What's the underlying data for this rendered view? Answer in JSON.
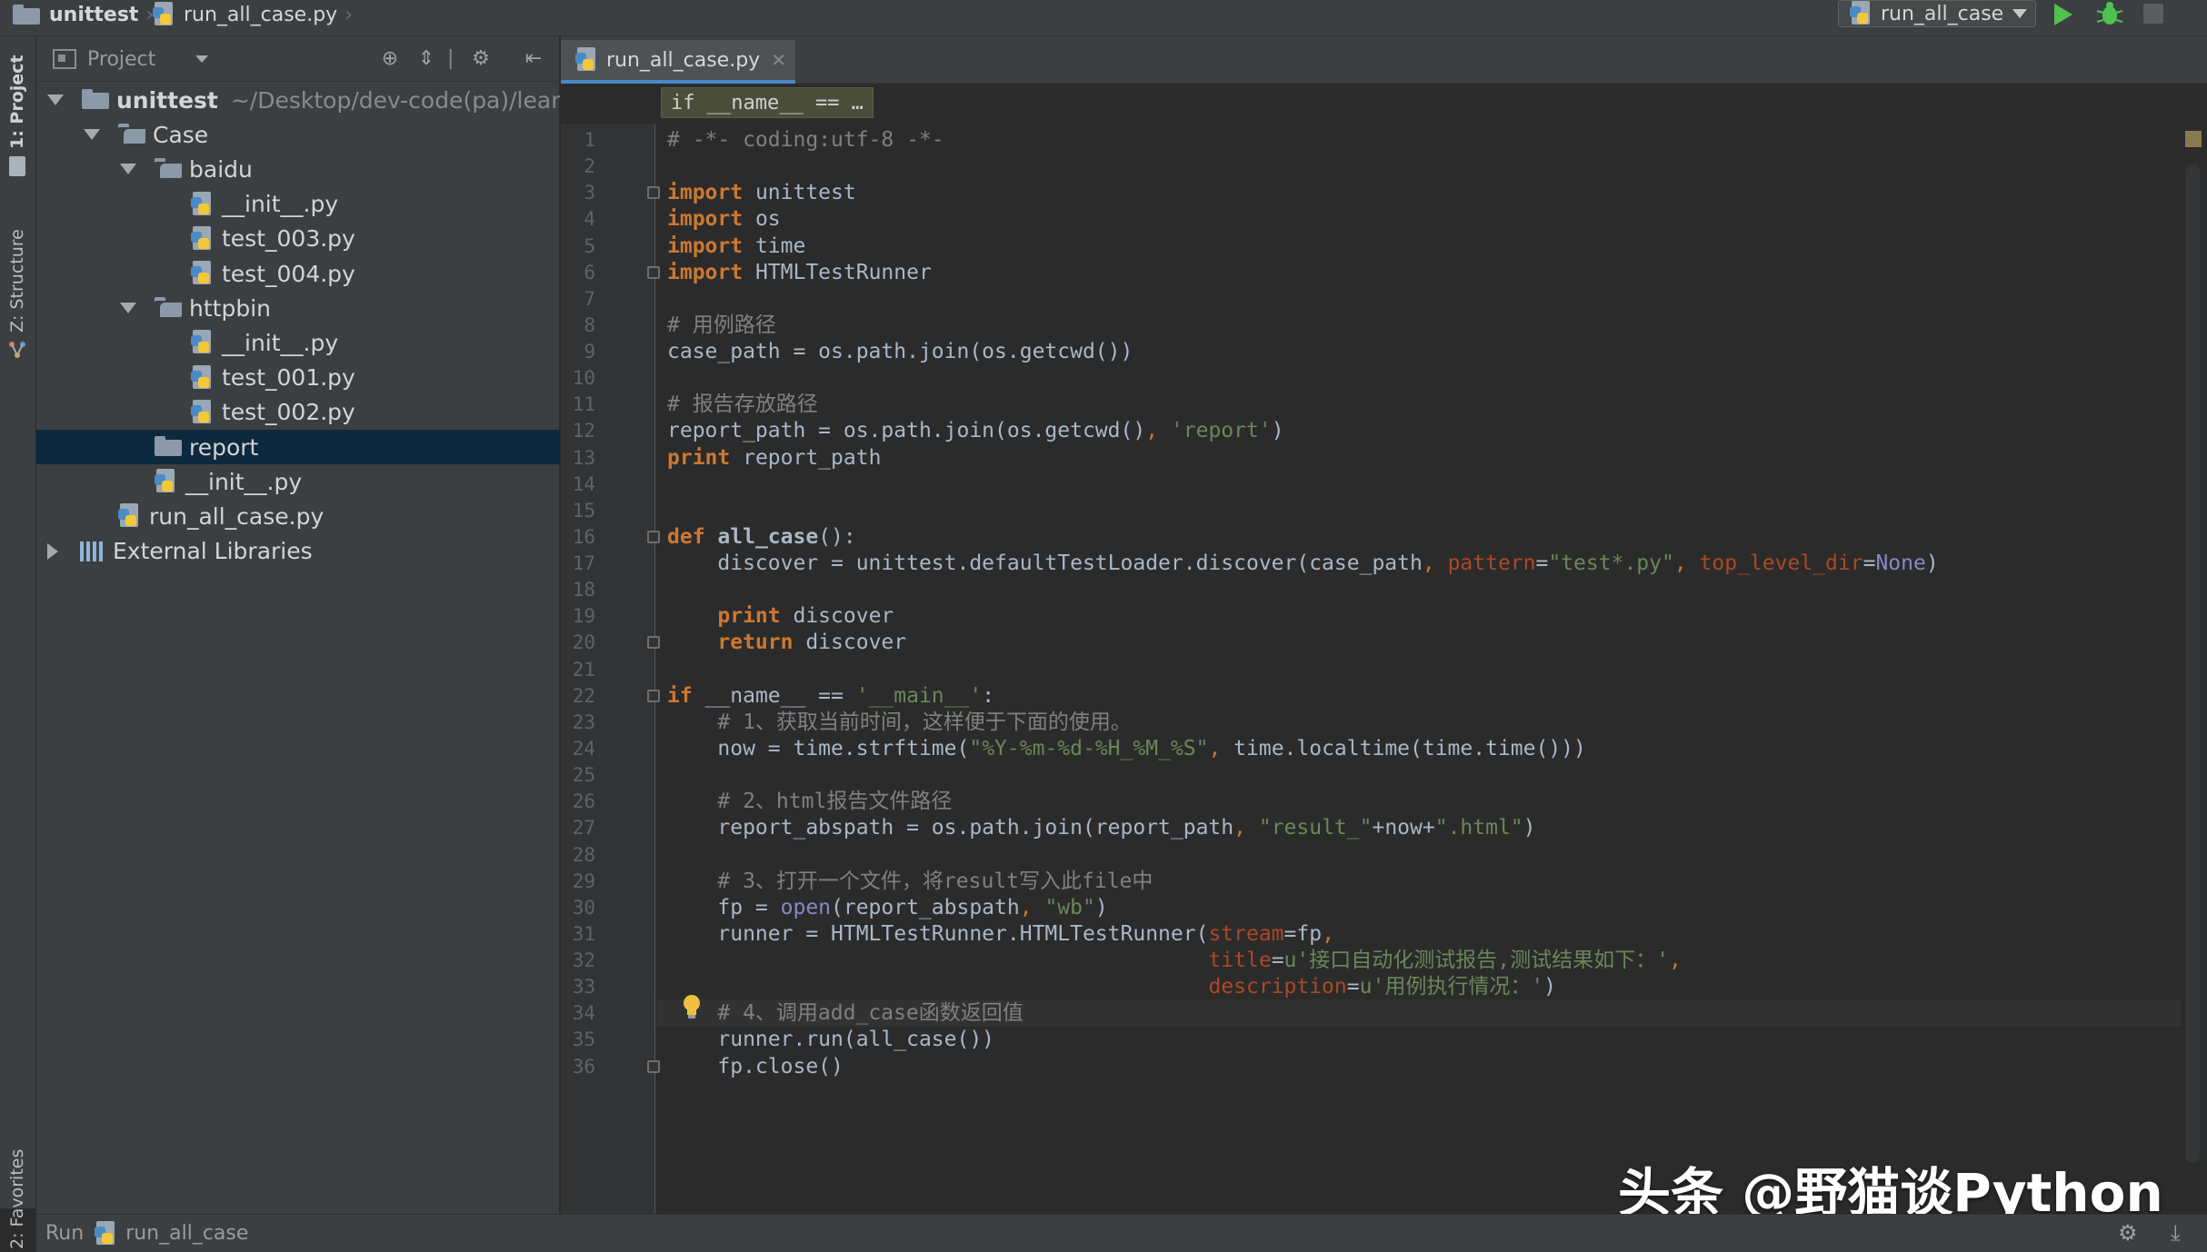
{
  "navbar": {
    "crumbs": [
      "unittest",
      "run_all_case.py"
    ],
    "run_config": "run_all_case"
  },
  "left_strip": {
    "project_tab": "1: Project",
    "structure_tab": "Z: Structure",
    "favorites_tab": "2: Favorites"
  },
  "project_panel": {
    "view": "Project",
    "tree": [
      {
        "label": "unittest",
        "path": "~/Desktop/dev-code(pa)/lear",
        "type": "folder",
        "level": 0,
        "expanded": true
      },
      {
        "label": "Case",
        "type": "package",
        "level": 1,
        "expanded": true
      },
      {
        "label": "baidu",
        "type": "package",
        "level": 2,
        "expanded": true
      },
      {
        "label": "__init__.py",
        "type": "py",
        "level": 3
      },
      {
        "label": "test_003.py",
        "type": "py",
        "level": 3
      },
      {
        "label": "test_004.py",
        "type": "py",
        "level": 3
      },
      {
        "label": "httpbin",
        "type": "package",
        "level": 2,
        "expanded": true
      },
      {
        "label": "__init__.py",
        "type": "py",
        "level": 3
      },
      {
        "label": "test_001.py",
        "type": "py",
        "level": 3
      },
      {
        "label": "test_002.py",
        "type": "py",
        "level": 3
      },
      {
        "label": "report",
        "type": "folder",
        "level": 2,
        "selected": true
      },
      {
        "label": "__init__.py",
        "type": "py",
        "level": 2
      },
      {
        "label": "run_all_case.py",
        "type": "py",
        "level": 1
      },
      {
        "label": "External Libraries",
        "type": "libs",
        "level": 0
      }
    ]
  },
  "editor": {
    "tab_label": "run_all_case.py",
    "breadcrumb": "if __name__ == …",
    "current_line": 34,
    "lines": [
      [
        [
          "cm",
          "# -*- coding:utf-8 -*-"
        ]
      ],
      [],
      [
        [
          "kw",
          "import"
        ],
        [
          "",
          " unittest"
        ]
      ],
      [
        [
          "kw",
          "import"
        ],
        [
          "",
          " os"
        ]
      ],
      [
        [
          "kw",
          "import"
        ],
        [
          "",
          " time"
        ]
      ],
      [
        [
          "kw",
          "import"
        ],
        [
          "",
          " HTMLTestRunner"
        ]
      ],
      [],
      [
        [
          "cm",
          "# 用例路径"
        ]
      ],
      [
        [
          "",
          "case_path = os.path.join(os.getcwd())"
        ]
      ],
      [],
      [
        [
          "cm",
          "# 报告存放路径"
        ]
      ],
      [
        [
          "",
          "report_path = os.path.join(os.getcwd()"
        ],
        [
          "pu",
          ","
        ],
        [
          "",
          " "
        ],
        [
          "st",
          "'report'"
        ],
        [
          "",
          ")"
        ]
      ],
      [
        [
          "kw",
          "print"
        ],
        [
          "",
          " report_path"
        ]
      ],
      [],
      [],
      [
        [
          "kw",
          "def"
        ],
        [
          "",
          " "
        ],
        [
          "fname",
          "all_case"
        ],
        [
          "",
          "():"
        ]
      ],
      [
        [
          "",
          "    discover = unittest.defaultTestLoader.discover(case_path"
        ],
        [
          "pu",
          ","
        ],
        [
          "",
          " "
        ],
        [
          "kwa",
          "pattern"
        ],
        [
          "",
          "="
        ],
        [
          "st",
          "\"test*.py\""
        ],
        [
          "pu",
          ","
        ],
        [
          "",
          " "
        ],
        [
          "kwa",
          "top_level_dir"
        ],
        [
          "",
          "="
        ],
        [
          "bi",
          "None"
        ],
        [
          "",
          ")"
        ]
      ],
      [],
      [
        [
          "",
          "    "
        ],
        [
          "kw",
          "print"
        ],
        [
          "",
          " discover"
        ]
      ],
      [
        [
          "",
          "    "
        ],
        [
          "kw",
          "return"
        ],
        [
          "",
          " discover"
        ]
      ],
      [],
      [
        [
          "kw",
          "if"
        ],
        [
          "",
          " __name__ == "
        ],
        [
          "st",
          "'__main__'"
        ],
        [
          "",
          ":"
        ]
      ],
      [
        [
          "",
          "    "
        ],
        [
          "cm",
          "# 1、获取当前时间，这样便于下面的使用。"
        ]
      ],
      [
        [
          "",
          "    now = time.strftime("
        ],
        [
          "st",
          "\"%Y-%m-%d-%H_%M_%S\""
        ],
        [
          "pu",
          ","
        ],
        [
          "",
          " time.localtime(time.time()))"
        ]
      ],
      [],
      [
        [
          "",
          "    "
        ],
        [
          "cm",
          "# 2、html报告文件路径"
        ]
      ],
      [
        [
          "",
          "    report_abspath = os.path.join(report_path"
        ],
        [
          "pu",
          ","
        ],
        [
          "",
          " "
        ],
        [
          "st",
          "\"result_\""
        ],
        [
          "",
          "+now+"
        ],
        [
          "st",
          "\".html\""
        ],
        [
          "",
          ")"
        ]
      ],
      [],
      [
        [
          "",
          "    "
        ],
        [
          "cm",
          "# 3、打开一个文件，将result写入此file中"
        ]
      ],
      [
        [
          "",
          "    fp = "
        ],
        [
          "bi",
          "open"
        ],
        [
          "",
          "(report_abspath"
        ],
        [
          "pu",
          ","
        ],
        [
          "",
          " "
        ],
        [
          "st",
          "\"wb\""
        ],
        [
          "",
          ")"
        ]
      ],
      [
        [
          "",
          "    runner = HTMLTestRunner.HTMLTestRunner("
        ],
        [
          "kwa",
          "stream"
        ],
        [
          "",
          "=fp"
        ],
        [
          "pu",
          ","
        ]
      ],
      [
        [
          "",
          "                                           "
        ],
        [
          "kwa",
          "title"
        ],
        [
          "",
          "="
        ],
        [
          "st",
          "u'接口自动化测试报告,测试结果如下：'"
        ],
        [
          "pu",
          ","
        ]
      ],
      [
        [
          "",
          "                                           "
        ],
        [
          "kwa",
          "description"
        ],
        [
          "",
          "="
        ],
        [
          "st",
          "u'用例执行情况：'"
        ],
        [
          "",
          ")"
        ]
      ],
      [
        [
          "",
          "    "
        ],
        [
          "cm",
          "# 4、调用add_case函数返回值"
        ]
      ],
      [
        [
          "",
          "    runner.run(all_case())"
        ]
      ],
      [
        [
          "",
          "    fp.close()"
        ]
      ]
    ],
    "fold_lines": [
      3,
      6,
      16,
      20,
      22,
      36
    ]
  },
  "run_bar": {
    "label": "Run",
    "config": "run_all_case"
  },
  "watermark": "头条 @野猫谈Python",
  "colors": {
    "keyword": "#cc7832",
    "comment": "#808080",
    "string": "#6a8759",
    "selection": "#0d293e",
    "tab_accent": "#4a88c7"
  }
}
